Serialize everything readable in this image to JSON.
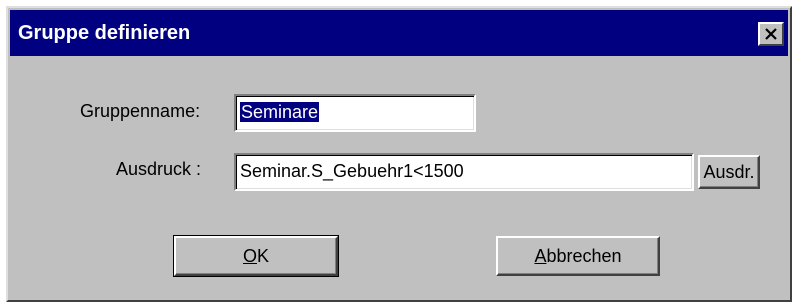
{
  "dialog": {
    "title": "Gruppe definieren",
    "close_icon": "close-icon"
  },
  "form": {
    "group_name_label": "Gruppenname:",
    "group_name_value": "Seminare",
    "expression_label": "Ausdruck :",
    "expression_value": "Seminar.S_Gebuehr1<1500",
    "expression_button_label": "Ausdr."
  },
  "buttons": {
    "ok_mnemonic": "O",
    "ok_rest": "K",
    "cancel_mnemonic": "A",
    "cancel_rest": "bbrechen"
  },
  "colors": {
    "titlebar": "#000080",
    "dialog_face": "#c0c0c0",
    "selection": "#000080"
  }
}
